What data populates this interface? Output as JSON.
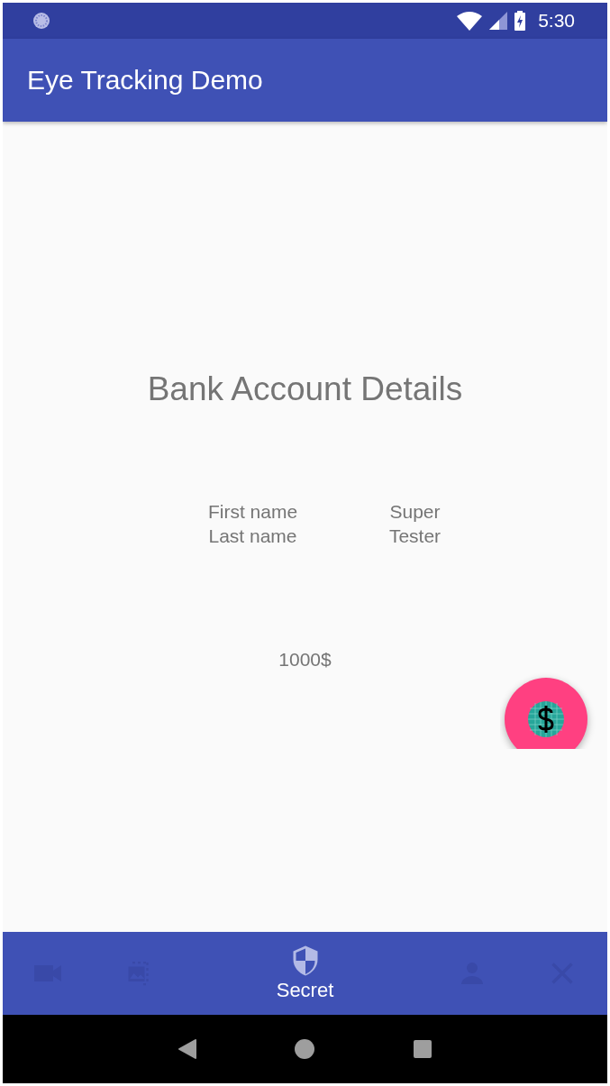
{
  "status_bar": {
    "time": "5:30"
  },
  "app_bar": {
    "title": "Eye Tracking Demo"
  },
  "content": {
    "heading": "Bank Account Details",
    "fields": [
      {
        "label": "First name",
        "value": "Super"
      },
      {
        "label": "Last name",
        "value": "Tester"
      }
    ],
    "amount": "1000$"
  },
  "bottom_nav": [
    {
      "selected": false
    },
    {
      "selected": false
    },
    {
      "label": "Secret",
      "selected": true
    },
    {
      "selected": false
    },
    {
      "selected": false
    }
  ]
}
